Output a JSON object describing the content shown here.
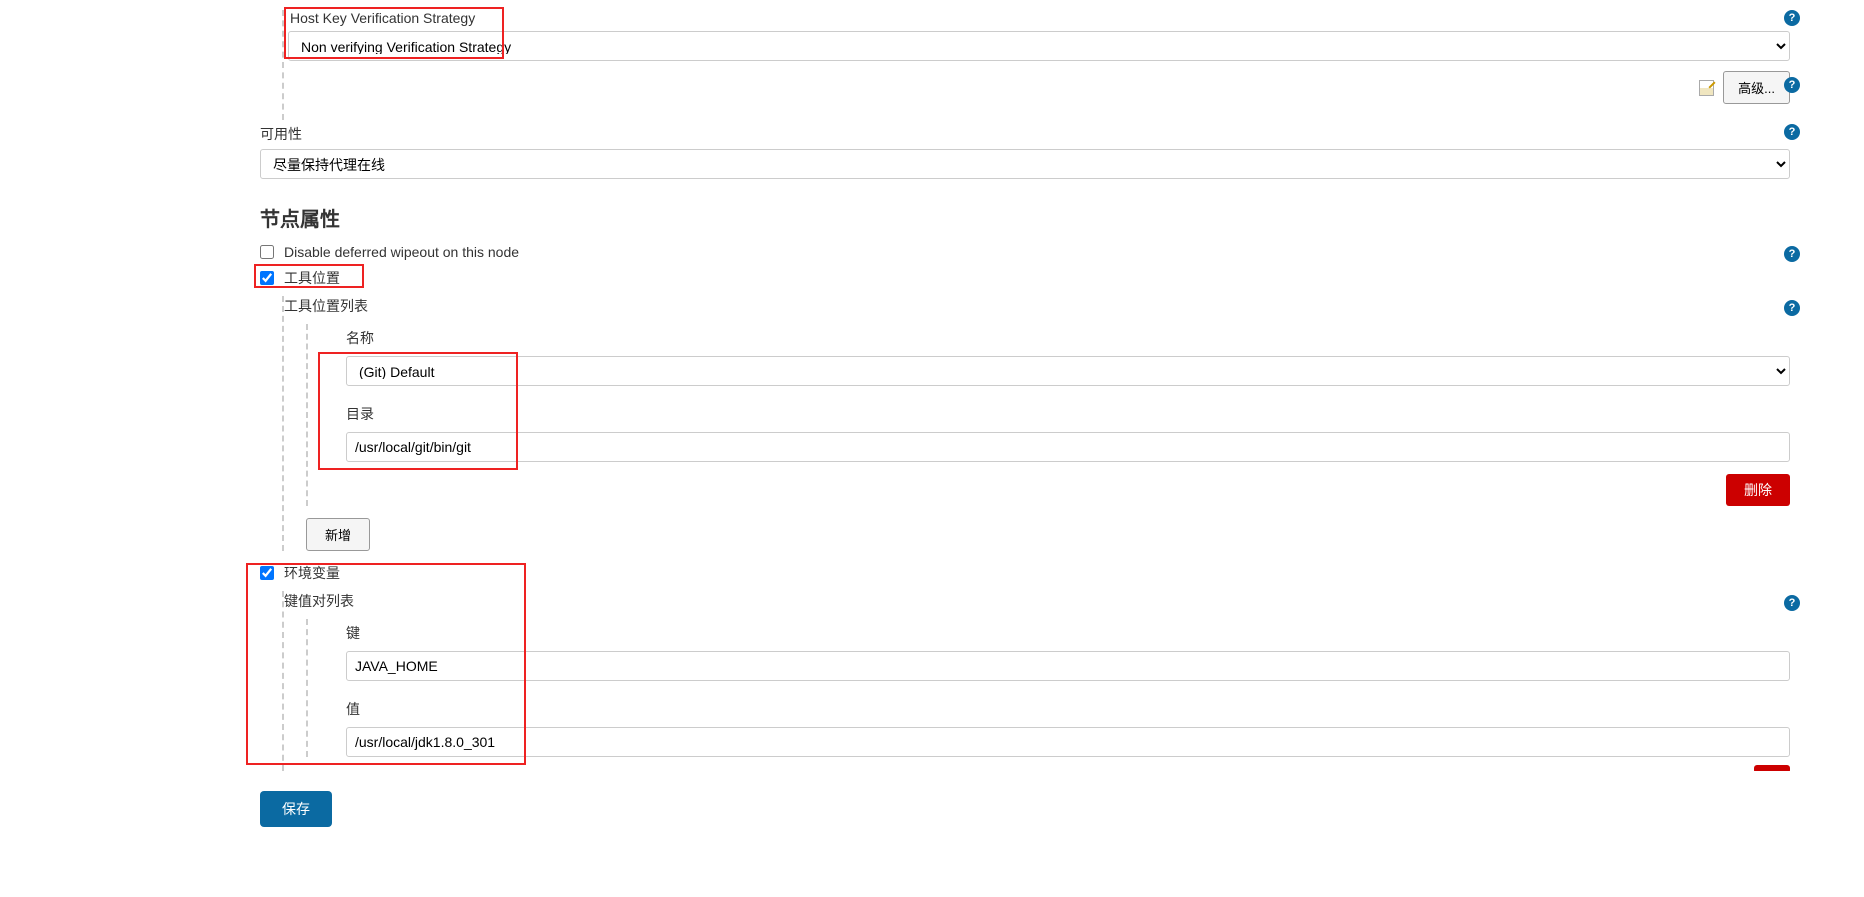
{
  "hostkey": {
    "label": "Host Key Verification Strategy",
    "value": "Non verifying Verification Strategy"
  },
  "advanced": {
    "label": "高级..."
  },
  "availability": {
    "label": "可用性",
    "value": "尽量保持代理在线"
  },
  "nodeProps": {
    "title": "节点属性",
    "disableDeferred": {
      "label": "Disable deferred wipeout on this node",
      "checked": false
    },
    "toolLocation": {
      "label": "工具位置",
      "checked": true,
      "listLabel": "工具位置列表",
      "nameLabel": "名称",
      "nameValue": "(Git) Default",
      "dirLabel": "目录",
      "dirValue": "/usr/local/git/bin/git",
      "deleteLabel": "删除",
      "addLabel": "新增"
    },
    "envVars": {
      "label": "环境变量",
      "checked": true,
      "listLabel": "键值对列表",
      "keyLabel": "键",
      "keyValue": "JAVA_HOME",
      "valueLabel": "值",
      "valueValue": "/usr/local/jdk1.8.0_301"
    }
  },
  "saveLabel": "保存"
}
